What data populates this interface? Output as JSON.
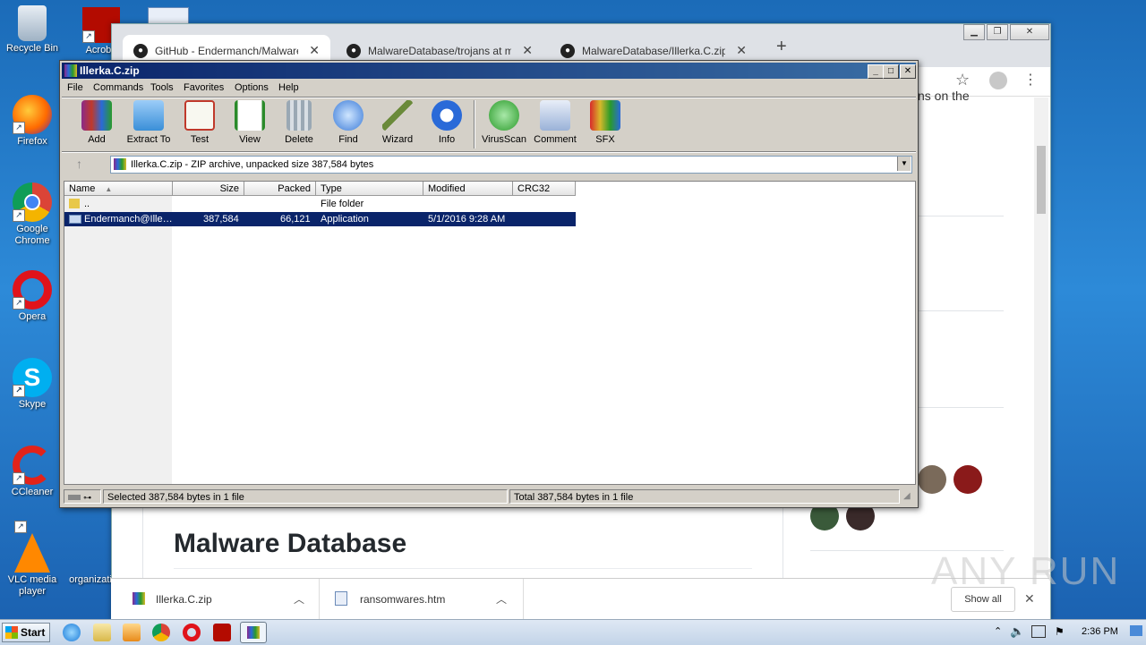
{
  "desktop": {
    "icons": [
      {
        "label": "Recycle Bin"
      },
      {
        "label": "Acroba"
      },
      {
        "label": "Firefox"
      },
      {
        "label": "Google Chrome"
      },
      {
        "label": "Opera"
      },
      {
        "label": "Skype"
      },
      {
        "label": "CCleaner"
      },
      {
        "label": "VLC media player"
      },
      {
        "label": "organizati"
      }
    ]
  },
  "chrome": {
    "tabs": [
      {
        "title": "GitHub - Endermanch/MalwareDatab"
      },
      {
        "title": "MalwareDatabase/trojans at master"
      },
      {
        "title": "MalwareDatabase/Illerka.C.zip at ma"
      }
    ],
    "new_tab_glyph": "+",
    "close_glyph": "✕",
    "page_fragment": "ns on the",
    "heading": "Malware Database"
  },
  "winrar": {
    "title": "Illerka.C.zip",
    "menu": [
      "File",
      "Commands",
      "Tools",
      "Favorites",
      "Options",
      "Help"
    ],
    "toolbar": [
      {
        "label": "Add",
        "icon": "add-icon",
        "color": "#c0392b"
      },
      {
        "label": "Extract To",
        "icon": "folder-icon",
        "color": "#3a8fd8"
      },
      {
        "label": "Test",
        "icon": "test-icon",
        "color": "#c0392b"
      },
      {
        "label": "View",
        "icon": "book-icon",
        "color": "#3a9a3a"
      },
      {
        "label": "Delete",
        "icon": "trash-icon",
        "color": "#8a9aa8"
      },
      {
        "label": "Find",
        "icon": "magnifier-icon",
        "color": "#3a7ad8"
      },
      {
        "label": "Wizard",
        "icon": "wand-icon",
        "color": "#6a8a3a"
      },
      {
        "label": "Info",
        "icon": "info-icon",
        "color": "#2a6ad8"
      },
      {
        "label": "VirusScan",
        "icon": "bug-icon",
        "color": "#2a9a2a"
      },
      {
        "label": "Comment",
        "icon": "comment-icon",
        "color": "#6a8ab8"
      },
      {
        "label": "SFX",
        "icon": "sfx-icon",
        "color": "#d86a2a"
      }
    ],
    "address": "Illerka.C.zip - ZIP archive, unpacked size 387,584 bytes",
    "columns": [
      "Name",
      "Size",
      "Packed",
      "Type",
      "Modified",
      "CRC32"
    ],
    "rows": [
      {
        "name": "..",
        "size": "",
        "packed": "",
        "type": "File folder",
        "modified": ""
      },
      {
        "name": "Endermanch@Ille…",
        "size": "387,584",
        "packed": "66,121",
        "type": "Application",
        "modified": "5/1/2016 9:28 AM"
      }
    ],
    "status_left": "Selected 387,584 bytes in 1 file",
    "status_right": "Total 387,584 bytes in 1 file"
  },
  "downloads": {
    "items": [
      {
        "name": "Illerka.C.zip"
      },
      {
        "name": "ransomwares.htm"
      }
    ],
    "show_all": "Show all"
  },
  "watermark": "ANY RUN",
  "taskbar": {
    "start": "Start",
    "clock": "2:36 PM"
  }
}
